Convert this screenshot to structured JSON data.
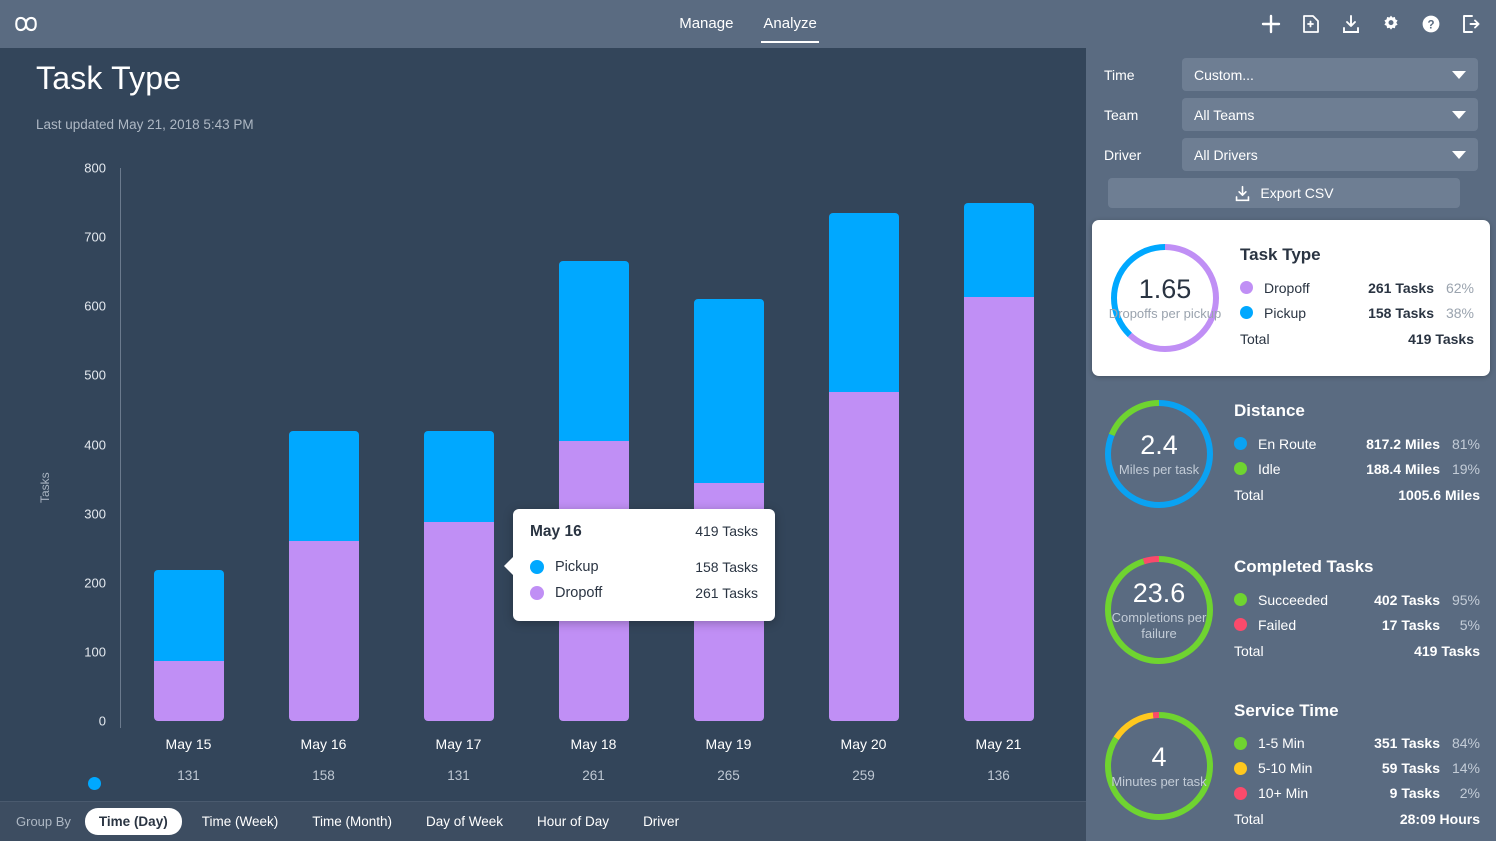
{
  "topbar": {
    "logo_icon": "infinity-logo",
    "nav": [
      {
        "label": "Manage",
        "active": false
      },
      {
        "label": "Analyze",
        "active": true
      }
    ],
    "icons": [
      {
        "name": "plus-icon"
      },
      {
        "name": "add-document-icon"
      },
      {
        "name": "download-icon"
      },
      {
        "name": "gear-icon"
      },
      {
        "name": "help-icon"
      },
      {
        "name": "logout-icon"
      }
    ]
  },
  "page": {
    "title": "Task Type",
    "last_updated": "Last updated May 21, 2018 5:43 PM"
  },
  "chart_data": {
    "type": "bar",
    "title": "Task Type",
    "stacked": true,
    "xlabel": "",
    "ylabel": "Tasks",
    "ylim": [
      0,
      800
    ],
    "yticks": [
      800,
      700,
      600,
      500,
      400,
      300,
      200,
      100,
      0
    ],
    "grid": false,
    "legend": [
      "Pickup",
      "Dropoff"
    ],
    "categories": [
      "May 15",
      "May 16",
      "May 17",
      "May 18",
      "May 19",
      "May 20",
      "May 21"
    ],
    "series": [
      {
        "name": "Pickup",
        "color": "#00A8FF",
        "values": [
          131,
          158,
          131,
          261,
          265,
          259,
          136
        ]
      },
      {
        "name": "Dropoff",
        "color": "#C08FF5",
        "values": [
          87,
          261,
          288,
          405,
          345,
          476,
          613
        ]
      }
    ],
    "totals": [
      218,
      419,
      419,
      666,
      610,
      735,
      749
    ]
  },
  "tooltip": {
    "date": "May 16",
    "total": "419 Tasks",
    "rows": [
      {
        "label": "Pickup",
        "value": "158 Tasks",
        "color": "#00A8FF"
      },
      {
        "label": "Dropoff",
        "value": "261 Tasks",
        "color": "#C08FF5"
      }
    ]
  },
  "groupby": {
    "label": "Group By",
    "options": [
      {
        "label": "Time (Day)",
        "active": true
      },
      {
        "label": "Time (Week)",
        "active": false
      },
      {
        "label": "Time (Month)",
        "active": false
      },
      {
        "label": "Day of Week",
        "active": false
      },
      {
        "label": "Hour of Day",
        "active": false
      },
      {
        "label": "Driver",
        "active": false
      }
    ]
  },
  "sidebar": {
    "filters": [
      {
        "label": "Time",
        "value": "Custom..."
      },
      {
        "label": "Team",
        "value": "All Teams"
      },
      {
        "label": "Driver",
        "value": "All Drivers"
      }
    ],
    "export_label": "Export CSV",
    "export_icon": "download-icon",
    "cards": [
      {
        "theme": "highlight",
        "title": "Task Type",
        "donut_value": "1.65",
        "donut_caption": "Dropoffs per pickup",
        "donut_segments": [
          {
            "color": "#C08FF5",
            "pct": 62
          },
          {
            "color": "#00A8FF",
            "pct": 38
          }
        ],
        "rows": [
          {
            "label": "Dropoff",
            "amount": "261 Tasks",
            "pct": "62%",
            "color": "#C08FF5"
          },
          {
            "label": "Pickup",
            "amount": "158 Tasks",
            "pct": "38%",
            "color": "#00A8FF"
          }
        ],
        "total_label": "Total",
        "total_value": "419 Tasks"
      },
      {
        "theme": "dark",
        "title": "Distance",
        "donut_value": "2.4",
        "donut_caption": "Miles per task",
        "donut_segments": [
          {
            "color": "#0AA2F2",
            "pct": 81
          },
          {
            "color": "#6FD430",
            "pct": 19
          }
        ],
        "rows": [
          {
            "label": "En Route",
            "amount": "817.2 Miles",
            "pct": "81%",
            "color": "#0AA2F2"
          },
          {
            "label": "Idle",
            "amount": "188.4 Miles",
            "pct": "19%",
            "color": "#6FD430"
          }
        ],
        "total_label": "Total",
        "total_value": "1005.6 Miles"
      },
      {
        "theme": "dark",
        "title": "Completed Tasks",
        "donut_value": "23.6",
        "donut_caption": "Completions per failure",
        "donut_segments": [
          {
            "color": "#6FD430",
            "pct": 95
          },
          {
            "color": "#FB4A6B",
            "pct": 5
          }
        ],
        "rows": [
          {
            "label": "Succeeded",
            "amount": "402 Tasks",
            "pct": "95%",
            "color": "#6FD430"
          },
          {
            "label": "Failed",
            "amount": "17 Tasks",
            "pct": "5%",
            "color": "#FB4A6B"
          }
        ],
        "total_label": "Total",
        "total_value": "419 Tasks"
      },
      {
        "theme": "dark",
        "title": "Service Time",
        "donut_value": "4",
        "donut_caption": "Minutes per task",
        "donut_segments": [
          {
            "color": "#6FD430",
            "pct": 84
          },
          {
            "color": "#FFC81E",
            "pct": 14
          },
          {
            "color": "#FB4A6B",
            "pct": 2
          }
        ],
        "rows": [
          {
            "label": "1-5 Min",
            "amount": "351 Tasks",
            "pct": "84%",
            "color": "#6FD430"
          },
          {
            "label": "5-10 Min",
            "amount": "59 Tasks",
            "pct": "14%",
            "color": "#FFC81E"
          },
          {
            "label": "10+ Min",
            "amount": "9 Tasks",
            "pct": "2%",
            "color": "#FB4A6B"
          }
        ],
        "total_label": "Total",
        "total_value": "28:09 Hours"
      }
    ]
  }
}
